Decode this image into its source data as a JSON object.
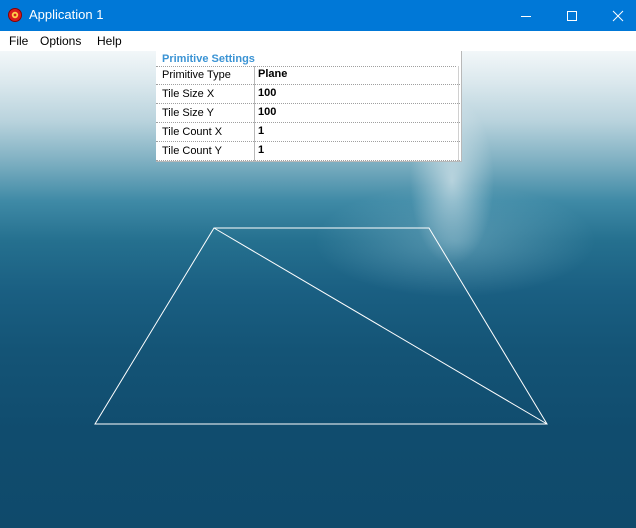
{
  "window": {
    "title": "Application 1",
    "icon": "app-red-circle-icon",
    "accent_color": "#0078d7"
  },
  "menu": {
    "items": [
      "File",
      "Options",
      "Help"
    ]
  },
  "property_grid": {
    "header": "Primitive Settings",
    "header_color": "#3a93d4",
    "rows": [
      {
        "name": "Primitive Type",
        "value": "Plane"
      },
      {
        "name": "Tile Size X",
        "value": "100"
      },
      {
        "name": "Tile Size Y",
        "value": "100"
      },
      {
        "name": "Tile Count X",
        "value": "1"
      },
      {
        "name": "Tile Count Y",
        "value": "1"
      }
    ]
  },
  "viewport": {
    "background": "ocean-sky-skybox",
    "mesh": "plane",
    "wireframe_color": "#ffffff"
  }
}
